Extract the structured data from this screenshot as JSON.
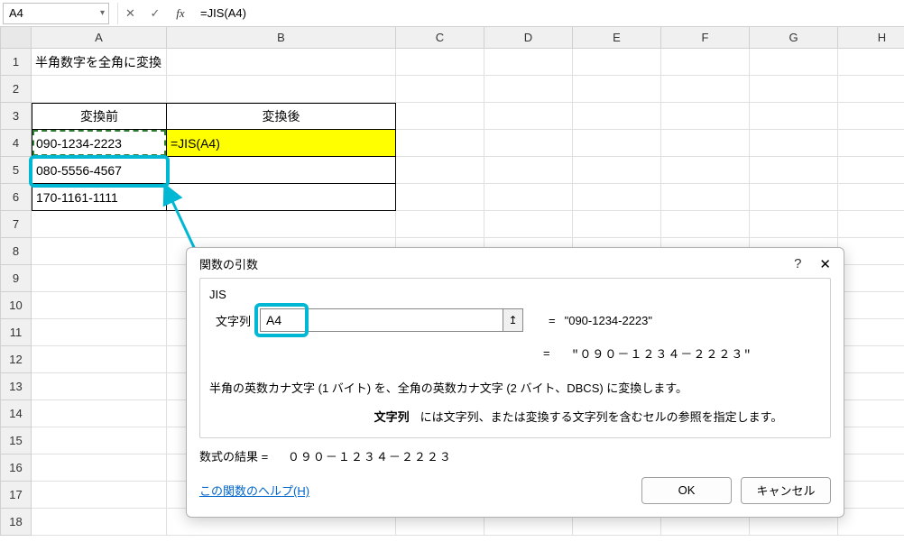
{
  "name_box": "A4",
  "formula_bar": {
    "cancel_glyph": "✕",
    "enter_glyph": "✓",
    "fx_glyph": "fx",
    "value": "=JIS(A4)"
  },
  "columns": [
    "A",
    "B",
    "C",
    "D",
    "E",
    "F",
    "G",
    "H"
  ],
  "rows": [
    "1",
    "2",
    "3",
    "4",
    "5",
    "6",
    "7",
    "8",
    "9",
    "10",
    "11",
    "12",
    "13",
    "14",
    "15",
    "16",
    "17",
    "18"
  ],
  "sheet": {
    "a1": "半角数字を全角に変換",
    "a3": "変換前",
    "b3": "変換後",
    "a4": "090-1234-2223",
    "b4": "=JIS(A4)",
    "a5": "080-5556-4567",
    "a6": "170-1161-1111"
  },
  "dialog": {
    "title": "関数の引数",
    "func_name": "JIS",
    "arg_label": "文字列",
    "arg_value": "A4",
    "arg_preview": "\"090-1234-2223\"",
    "result_preview": "\"０９０－１２３４－２２２３\"",
    "eq": "=",
    "description": "半角の英数カナ文字 (1 バイト) を、全角の英数カナ文字 (2 バイト、DBCS) に変換します。",
    "arg_desc_label": "文字列",
    "arg_desc_text": "には文字列、または変換する文字列を含むセルの参照を指定します。",
    "result_label": "数式の結果 =",
    "result_value": "０９０－１２３４－２２２３",
    "help_link": "この関数のヘルプ(H)",
    "ok": "OK",
    "cancel": "キャンセル",
    "refedit_glyph": "↥",
    "help_glyph": "?",
    "close_glyph": "✕"
  },
  "chart_data": {
    "type": "table",
    "title": "半角数字を全角に変換",
    "columns": [
      "変換前",
      "変換後"
    ],
    "rows": [
      [
        "090-1234-2223",
        "=JIS(A4)"
      ],
      [
        "080-5556-4567",
        ""
      ],
      [
        "170-1161-1111",
        ""
      ]
    ]
  }
}
